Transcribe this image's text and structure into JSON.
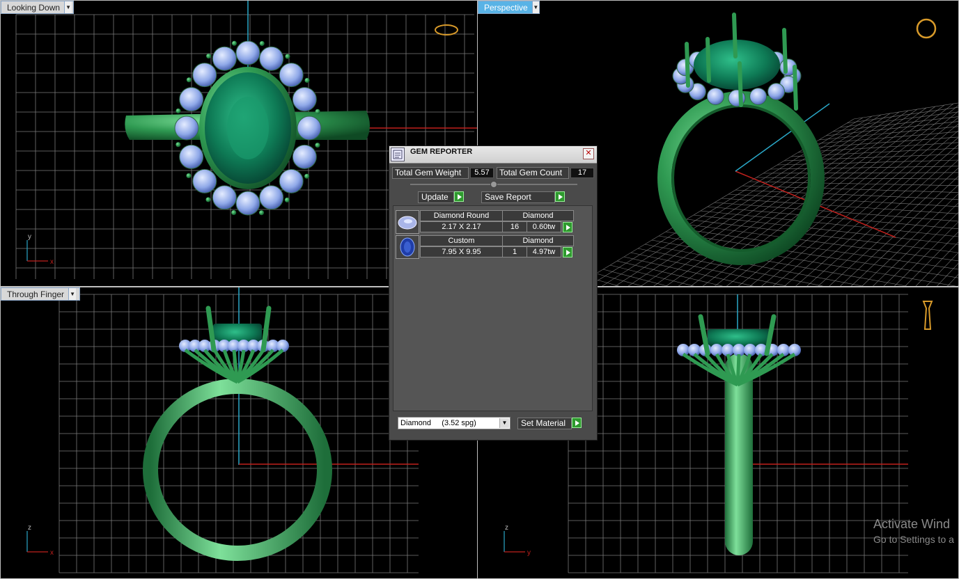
{
  "viewports": {
    "top_left": {
      "label": "Looking Down",
      "axis1": "y",
      "axis2": "x"
    },
    "top_right": {
      "label": "Perspective"
    },
    "bottom_left": {
      "label": "Through Finger",
      "axis1": "z",
      "axis2": "x"
    },
    "bottom_right": {
      "axis1": "z",
      "axis2": "y"
    }
  },
  "watermark": {
    "line1": "Activate Wind",
    "line2": "Go to Settings to a"
  },
  "gem_reporter": {
    "title": "GEM REPORTER",
    "total_weight_label": "Total Gem Weight",
    "total_weight": "5.57",
    "total_count_label": "Total Gem Count",
    "total_count": "17",
    "update_label": "Update",
    "save_report_label": "Save Report",
    "gems": [
      {
        "shape": "Diamond Round",
        "material": "Diamond",
        "size": "2.17 X 2.17",
        "count": "16",
        "weight": "0.60tw"
      },
      {
        "shape": "Custom",
        "material": "Diamond",
        "size": "7.95 X 9.95",
        "count": "1",
        "weight": "4.97tw"
      }
    ],
    "material_select": "Diamond     (3.52 spg)",
    "set_material_label": "Set Material"
  },
  "colors": {
    "metal": "#2f9a52",
    "gem_side": "#8fa8e8",
    "gem_center": "#0e7a55",
    "grid": "#7a7a7a",
    "axis_x": "#c0201c",
    "axis_y": "#2aa8c8"
  }
}
